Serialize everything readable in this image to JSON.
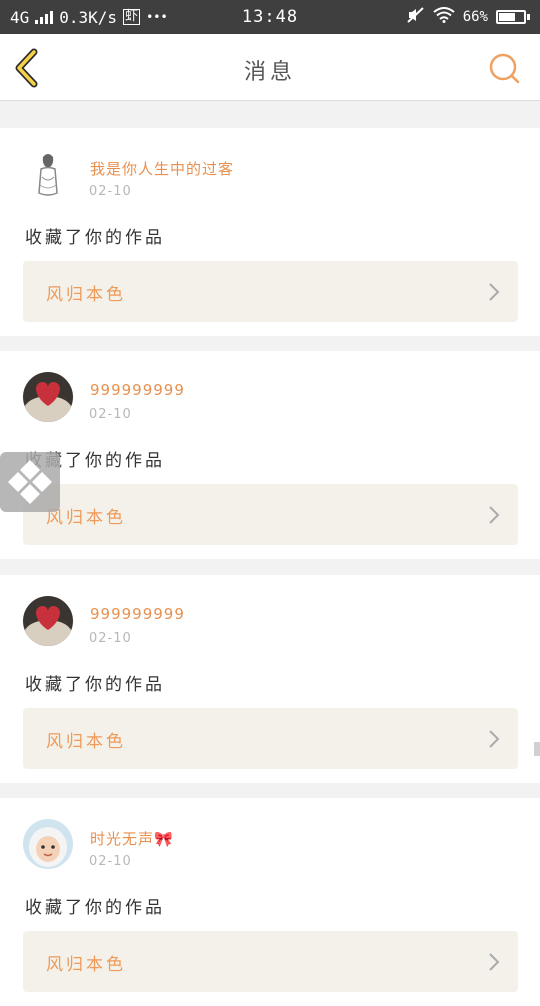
{
  "status_bar": {
    "network": "4G",
    "speed": "0.3K/s",
    "app_badge": "虾",
    "more": "•••",
    "time": "13:48",
    "battery_text": "66%",
    "battery_level": 0.66
  },
  "header": {
    "title": "消息"
  },
  "notifications": [
    {
      "user": "我是你人生中的过客",
      "date": "02-10",
      "action": "收藏了你的作品",
      "work": "风归本色",
      "avatar": "sketch-girl-avatar"
    },
    {
      "user": "999999999",
      "date": "02-10",
      "action": "收藏了你的作品",
      "work": "风归本色",
      "avatar": "heart-cake-avatar"
    },
    {
      "user": "999999999",
      "date": "02-10",
      "action": "收藏了你的作品",
      "work": "风归本色",
      "avatar": "heart-cake-avatar"
    },
    {
      "user": "时光无声🎀",
      "date": "02-10",
      "action": "收藏了你的作品",
      "work": "风归本色",
      "avatar": "baby-avatar"
    }
  ]
}
